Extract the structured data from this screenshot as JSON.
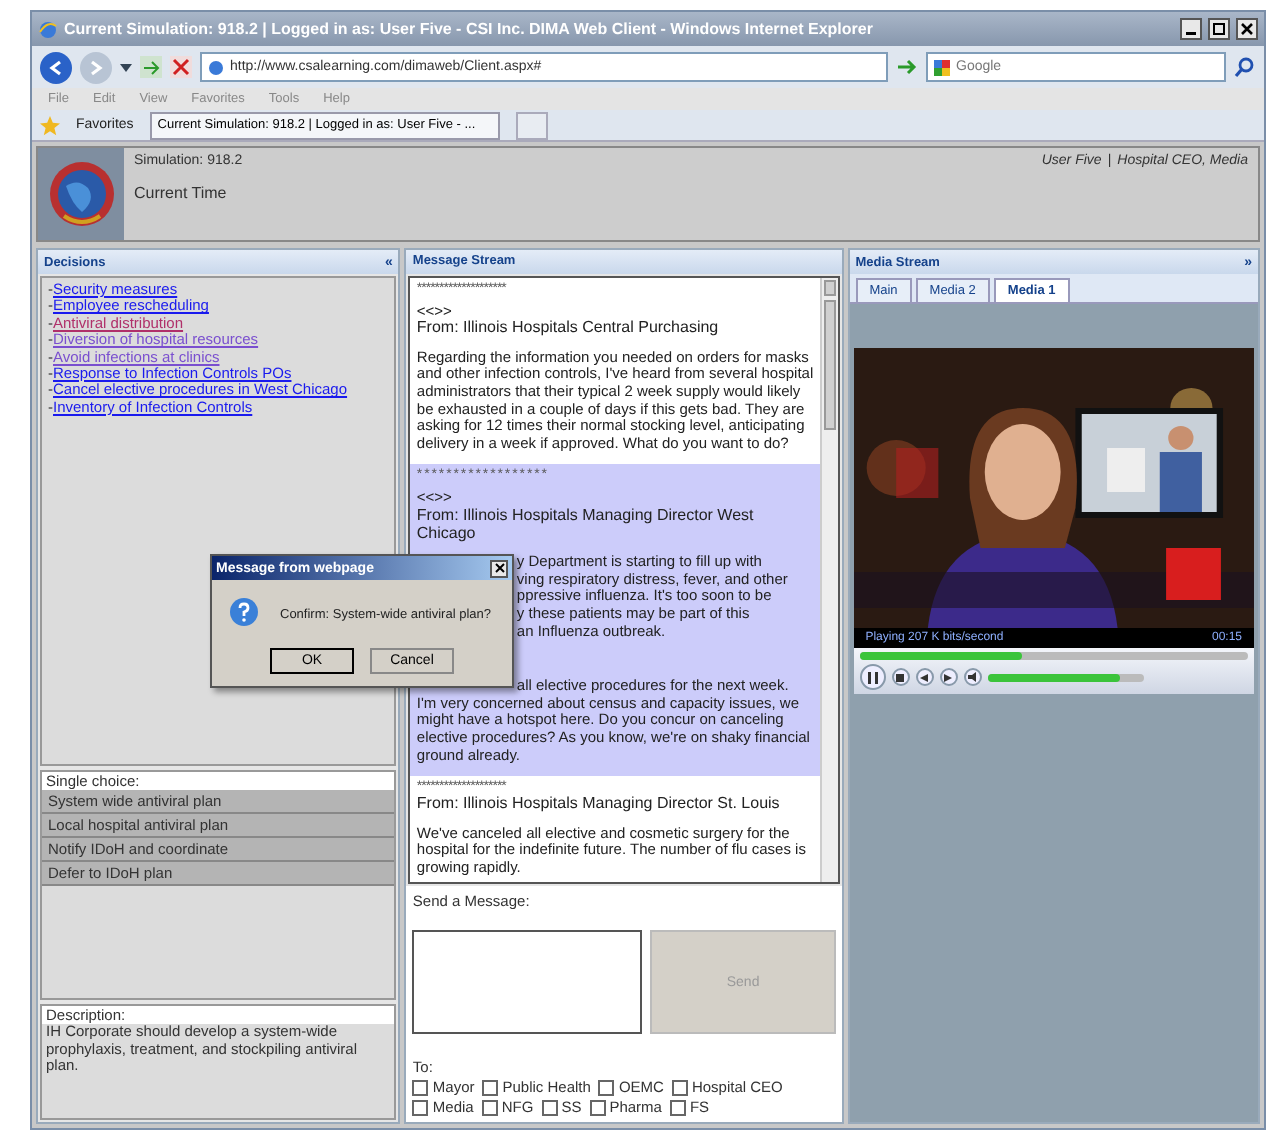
{
  "window": {
    "title": "Current Simulation: 918.2 | Logged in as: User Five - CSI Inc. DIMA Web Client - Windows Internet Explorer"
  },
  "address_bar": {
    "url": "http://www.csalearning.com/dimaweb/Client.aspx#",
    "search_placeholder": "Google"
  },
  "menu": [
    "File",
    "Edit",
    "View",
    "Favorites",
    "Tools",
    "Help"
  ],
  "favorites_bar": {
    "label": "Favorites",
    "tab": "Current Simulation: 918.2 | Logged in as: User Five - ..."
  },
  "header": {
    "simulation": "Simulation: 918.2",
    "time_label": "Current Time",
    "user": "User Five",
    "separator": "|",
    "role": "Hospital CEO, Media"
  },
  "decisions": {
    "title": "Decisions",
    "collapse": "«",
    "items": [
      {
        "marker": "-",
        "label": "Security measures",
        "visited": false,
        "selected": false
      },
      {
        "marker": "-",
        "label": "Employee rescheduling",
        "visited": false,
        "selected": false
      },
      {
        "marker": "-",
        "label": "Antiviral distribution",
        "visited": true,
        "selected": true
      },
      {
        "marker": "-",
        "label": "Diversion of hospital resources",
        "visited": true,
        "selected": false
      },
      {
        "marker": "-",
        "label": "Avoid infections at clinics",
        "visited": true,
        "selected": false
      },
      {
        "marker": "-",
        "label": "Response to Infection Controls POs",
        "visited": false,
        "selected": false
      },
      {
        "marker": "-",
        "label": "Cancel elective procedures in West Chicago",
        "visited": false,
        "selected": false
      },
      {
        "marker": "-",
        "label": "Inventory of Infection Controls",
        "visited": false,
        "selected": false
      }
    ],
    "choice_label": "Single choice:",
    "choices": [
      "System wide antiviral plan",
      "Local hospital antiviral plan",
      "Notify IDoH and coordinate",
      "Defer to IDoH plan"
    ],
    "description_label": "Description:",
    "description": "IH Corporate should develop a system-wide prophylaxis, treatment, and stockpiling antiviral plan."
  },
  "message_stream": {
    "title": "Message Stream",
    "messages": [
      {
        "separator": "********************",
        "tag": "<<>>",
        "from": "From: Illinois Hospitals Central Purchasing",
        "highlighted": false,
        "body": [
          "Regarding the information you needed on orders for masks and other infection controls, I've heard from several hospital administrators that their typical 2 week supply would likely be exhausted in a couple of days if this gets bad. They are asking for 12 times their normal stocking level, anticipating delivery in a week if approved. What do you want to do?"
        ]
      },
      {
        "separator": "* * * * * * * * * * * * * * * * * *",
        "tag": "<<>>",
        "from": "From: Illinois Hospitals Managing Director West Chicago",
        "highlighted": true,
        "partial_lines": [
          "y Department is starting to fill up with",
          "ving respiratory distress, fever, and other",
          "ppressive influenza. It's too soon to be",
          "y these patients may be part of this",
          "an Influenza outbreak."
        ],
        "body": [
          "all elective procedures for the next week.",
          "I'm very concerned about census and capacity issues, we might have a hotspot here. Do you concur on canceling elective procedures? As you know, we're on shaky financial ground already."
        ]
      },
      {
        "separator": "********************",
        "from": "From: Illinois Hospitals Managing Director St. Louis",
        "highlighted": false,
        "body": [
          "We've canceled all elective and cosmetic surgery for the hospital for the indefinite future. The number of flu cases is growing rapidly."
        ]
      }
    ],
    "send_label": "Send a Message:",
    "send_button": "Send",
    "to_label": "To:",
    "recipients": [
      {
        "label": "Mayor",
        "checked": false
      },
      {
        "label": "Public Health",
        "checked": false
      },
      {
        "label": "OEMC",
        "checked": false
      },
      {
        "label": "Hospital CEO",
        "checked": false
      },
      {
        "label": "Media",
        "checked": false
      },
      {
        "label": "NFG",
        "checked": false
      },
      {
        "label": "SS",
        "checked": false
      },
      {
        "label": "Pharma",
        "checked": false
      },
      {
        "label": "FS",
        "checked": false
      }
    ]
  },
  "media_stream": {
    "title": "Media Stream",
    "expand": "»",
    "tabs": [
      {
        "label": "Main",
        "selected": false
      },
      {
        "label": "Media 2",
        "selected": false
      },
      {
        "label": "Media 1",
        "selected": true
      }
    ],
    "player": {
      "status": "Playing  207 K bits/second",
      "time": "00:15",
      "position": {
        "level": 0.42
      },
      "volume": {
        "level": 0.85
      }
    }
  },
  "dialog": {
    "title": "Message from webpage",
    "message": "Confirm: System-wide antiviral plan?",
    "buttons": [
      "OK",
      "Cancel"
    ]
  }
}
